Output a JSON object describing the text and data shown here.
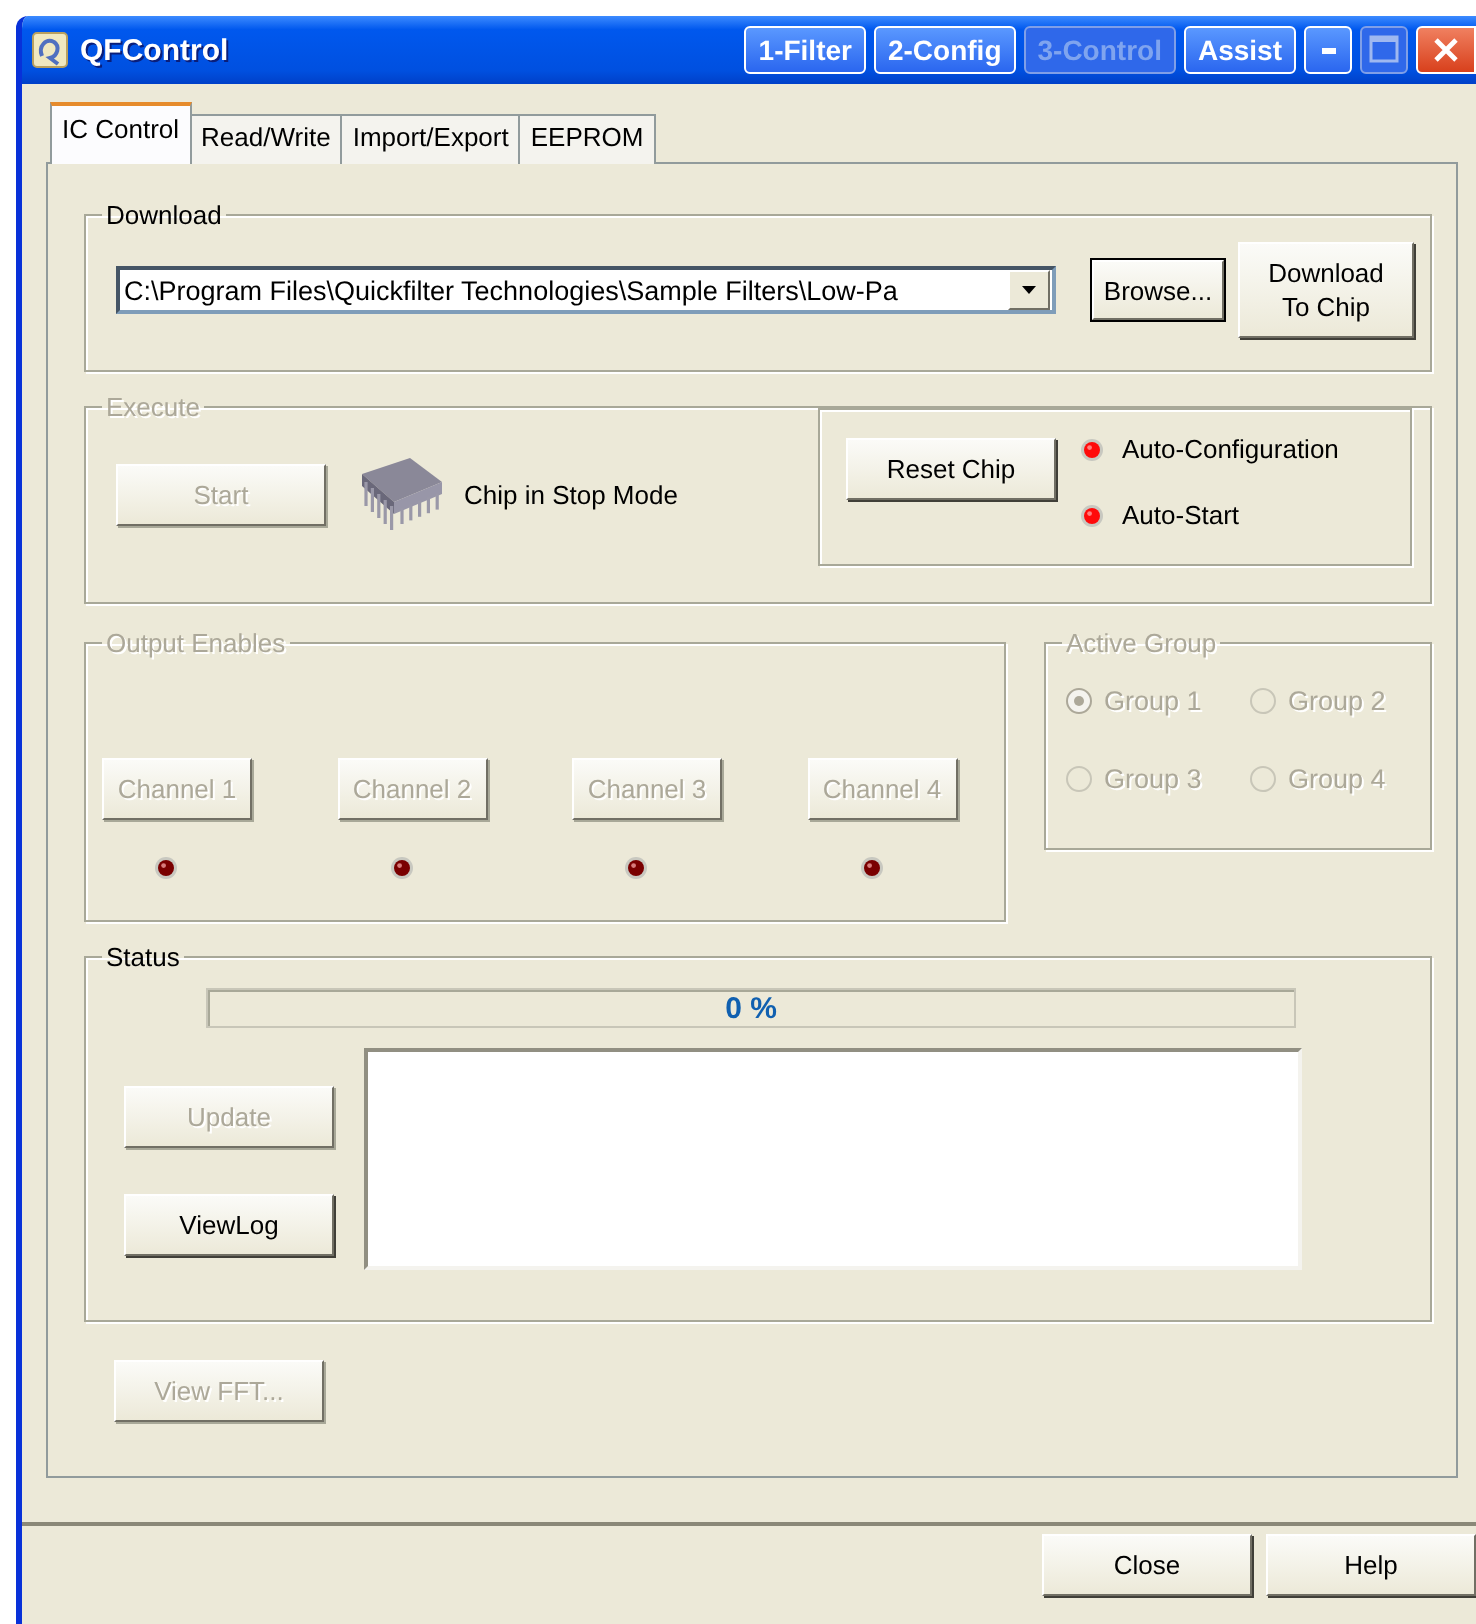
{
  "window": {
    "title": "QFControl"
  },
  "title_buttons": [
    {
      "label": "1-Filter",
      "disabled": false
    },
    {
      "label": "2-Config",
      "disabled": false
    },
    {
      "label": "3-Control",
      "disabled": true
    },
    {
      "label": "Assist",
      "disabled": false
    }
  ],
  "tabs": [
    {
      "label": "IC Control",
      "selected": true
    },
    {
      "label": "Read/Write",
      "selected": false
    },
    {
      "label": "Import/Export",
      "selected": false
    },
    {
      "label": "EEPROM",
      "selected": false
    }
  ],
  "download": {
    "label": "Download",
    "path": "C:\\Program Files\\Quickfilter Technologies\\Sample Filters\\Low-Pa",
    "browse": "Browse...",
    "send": [
      "Download",
      "To Chip"
    ]
  },
  "execute": {
    "label": "Execute",
    "disabled": true,
    "start": {
      "label": "Start",
      "disabled": true
    },
    "chip_state": "Chip in Stop Mode",
    "reset": "Reset Chip",
    "indicators": [
      {
        "label": "Auto-Configuration",
        "on": true
      },
      {
        "label": "Auto-Start",
        "on": true
      }
    ]
  },
  "output_enables": {
    "label": "Output Enables",
    "disabled": true,
    "channels": [
      {
        "label": "Channel 1",
        "disabled": true,
        "on": false
      },
      {
        "label": "Channel 2",
        "disabled": true,
        "on": false
      },
      {
        "label": "Channel 3",
        "disabled": true,
        "on": false
      },
      {
        "label": "Channel 4",
        "disabled": true,
        "on": false
      }
    ]
  },
  "active_group": {
    "label": "Active Group",
    "disabled": true,
    "groups": [
      {
        "label": "Group 1",
        "selected": true
      },
      {
        "label": "Group 2",
        "selected": false
      },
      {
        "label": "Group 3",
        "selected": false
      },
      {
        "label": "Group 4",
        "selected": false
      }
    ]
  },
  "status": {
    "label": "Status",
    "level": 0,
    "reading": "0 %",
    "update": {
      "label": "Update",
      "disabled": true
    },
    "view_log": {
      "label": "ViewLog",
      "disabled": false
    }
  },
  "view_fft": {
    "label": "View FFT...",
    "disabled": true
  },
  "footer_buttons": [
    "Close",
    "Help"
  ]
}
